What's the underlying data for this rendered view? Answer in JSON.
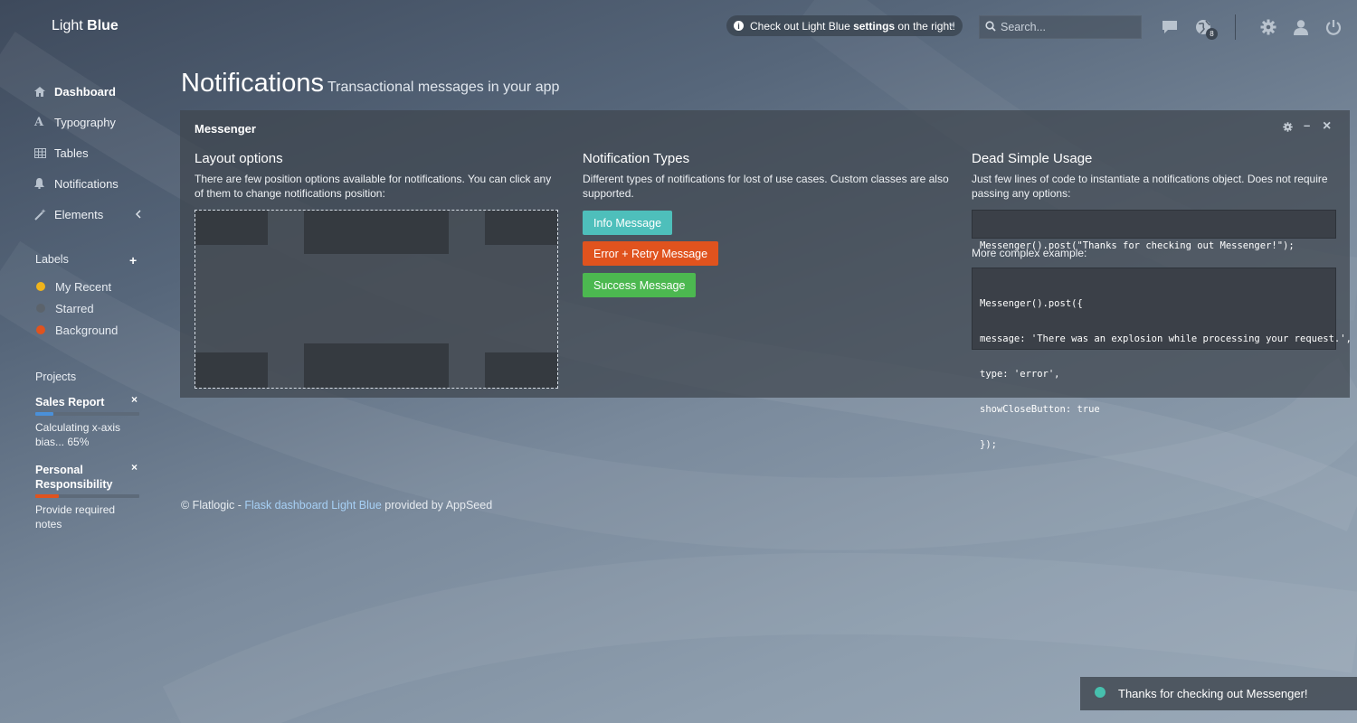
{
  "brand": {
    "light": "Light",
    "bold": "Blue"
  },
  "nav": [
    {
      "label": "Dashboard",
      "icon": "home-icon"
    },
    {
      "label": "Typography",
      "icon": "typography-icon"
    },
    {
      "label": "Tables",
      "icon": "table-icon"
    },
    {
      "label": "Notifications",
      "icon": "bell-icon"
    },
    {
      "label": "Elements",
      "icon": "magic-wand-icon"
    }
  ],
  "labels": {
    "title": "Labels",
    "items": [
      {
        "label": "My Recent",
        "color": "#f0b41c"
      },
      {
        "label": "Starred",
        "color": "#5b636c"
      },
      {
        "label": "Background",
        "color": "#e0531e"
      }
    ]
  },
  "projects": {
    "title": "Projects",
    "items": [
      {
        "name": "Sales Report",
        "desc": "Calculating x-axis bias... 65%",
        "progress": 0.17,
        "color": "#4a90d9"
      },
      {
        "name": "Personal Responsibility",
        "desc": "Provide required notes",
        "progress": 0.23,
        "color": "#e0531e"
      }
    ]
  },
  "topbar": {
    "alert_pre": "Check out Light Blue ",
    "alert_bold": "settings",
    "alert_post": " on the right!",
    "search_placeholder": "Search...",
    "badge": "8"
  },
  "page": {
    "title": "Notifications",
    "subtitle": "Transactional messages in your app"
  },
  "widget": {
    "title": "Messenger",
    "layout": {
      "heading": "Layout options",
      "text": "There are few position options available for notifications. You can click any of them to change notifications position:"
    },
    "types": {
      "heading": "Notification Types",
      "text": "Different types of notifications for lost of use cases. Custom classes are also supported.",
      "buttons": [
        {
          "label": "Info Message",
          "color": "#4ebfbb"
        },
        {
          "label": "Error + Retry Message",
          "color": "#e0531e"
        },
        {
          "label": "Success Message",
          "color": "#4cb850"
        }
      ]
    },
    "usage": {
      "heading": "Dead Simple Usage",
      "text": "Just few lines of code to instantiate a notifications object. Does not require passing any options:",
      "code1": "Messenger().post(\"Thanks for checking out Messenger!\");",
      "complex_label": "More complex example:",
      "code2": [
        "Messenger().post({",
        "message: 'There was an explosion while processing your request.',",
        "type: 'error',",
        "showCloseButton: true",
        "});"
      ]
    }
  },
  "footer": {
    "pre": "© Flatlogic - ",
    "link": "Flask dashboard Light Blue",
    "post": " provided by AppSeed"
  },
  "toast": {
    "text": "Thanks for checking out Messenger!"
  }
}
